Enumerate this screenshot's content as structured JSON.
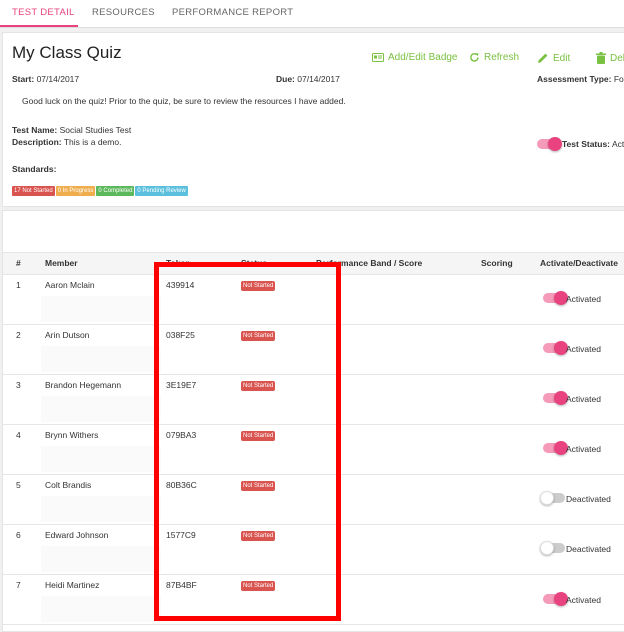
{
  "tabs": [
    {
      "label": "TEST DETAIL",
      "active": true
    },
    {
      "label": "RESOURCES",
      "active": false
    },
    {
      "label": "PERFORMANCE REPORT",
      "active": false
    }
  ],
  "quiz": {
    "title": "My Class Quiz",
    "start_label": "Start:",
    "start_value": "07/14/2017",
    "due_label": "Due:",
    "due_value": "07/14/2017",
    "assessment_type_label": "Assessment Type:",
    "assessment_type_value": "Form",
    "message": "Good luck on the quiz! Prior to the quiz, be sure to review the resources I have added.",
    "test_name_label": "Test Name:",
    "test_name_value": "Social Studies Test",
    "description_label": "Description:",
    "description_value": "This is a demo.",
    "standards_label": "Standards:",
    "test_status_label": "Test Status:",
    "test_status_value": "Activ",
    "test_status_on": true
  },
  "actions": {
    "add_badge": "Add/Edit Badge",
    "refresh": "Refresh",
    "edit": "Edit",
    "delete": "Dele"
  },
  "badges": [
    {
      "label": "17 Not Started",
      "color": "#d9534f"
    },
    {
      "label": "0 In Progress",
      "color": "#f0ad4e"
    },
    {
      "label": "0 Completed",
      "color": "#5cb85c"
    },
    {
      "label": "0 Pending Review",
      "color": "#5bc0de"
    }
  ],
  "table": {
    "headers": {
      "num": "#",
      "member": "Member",
      "token": "Token",
      "status": "Status",
      "band": "Performance Band / Score",
      "scoring": "Scoring",
      "activate": "Activate/Deactivate"
    },
    "rows": [
      {
        "num": "1",
        "member": "Aaron Mclain",
        "token": "439914",
        "status": "Not Started",
        "active": true,
        "active_label": "Activated"
      },
      {
        "num": "2",
        "member": "Arin Dutson",
        "token": "038F25",
        "status": "Not Started",
        "active": true,
        "active_label": "Activated"
      },
      {
        "num": "3",
        "member": "Brandon Hegemann",
        "token": "3E19E7",
        "status": "Not Started",
        "active": true,
        "active_label": "Activated"
      },
      {
        "num": "4",
        "member": "Brynn Withers",
        "token": "079BA3",
        "status": "Not Started",
        "active": true,
        "active_label": "Activated"
      },
      {
        "num": "5",
        "member": "Colt Brandis",
        "token": "80B36C",
        "status": "Not Started",
        "active": false,
        "active_label": "Deactivated"
      },
      {
        "num": "6",
        "member": "Edward Johnson",
        "token": "1577C9",
        "status": "Not Started",
        "active": false,
        "active_label": "Deactivated"
      },
      {
        "num": "7",
        "member": "Heidi Martinez",
        "token": "87B4BF",
        "status": "Not Started",
        "active": true,
        "active_label": "Activated"
      }
    ]
  },
  "colors": {
    "accent": "#e8437e",
    "action_green": "#7ac142",
    "highlight": "#ff0000",
    "status_red": "#d9534f"
  }
}
